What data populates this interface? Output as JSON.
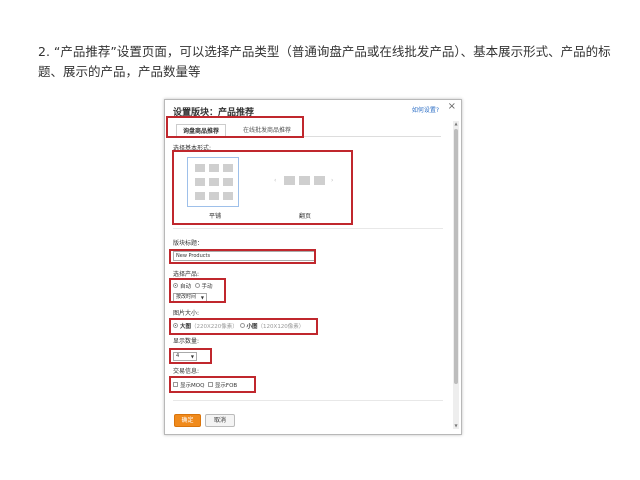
{
  "caption": "2. “产品推荐”设置页面，可以选择产品类型（普通询盘产品或在线批发产品）、基本展示形式、产品的标题、展示的产品，产品数量等",
  "dialog": {
    "title": "设置版块：产品推荐",
    "help_link": "如何设置?",
    "close": "×",
    "tabs": [
      "询盘商品推荐",
      "在线批发商品推荐"
    ]
  },
  "layout_section": {
    "label": "选择基本形式:",
    "options": [
      "平铺",
      "翻页"
    ]
  },
  "title_section": {
    "label": "版块标题：",
    "value": "New Products"
  },
  "product_section": {
    "label": "选择产品:",
    "radio_auto": "自动",
    "radio_manual": "手动",
    "sort_value": "按改时间"
  },
  "image_section": {
    "label": "图片大小:",
    "large": "大图",
    "large_size": "（220X220像素）",
    "small": "小图",
    "small_size": "（120X120像素）"
  },
  "count_section": {
    "label": "显示数量:",
    "value": "4"
  },
  "trade_section": {
    "label": "交易信息:",
    "moq": "显示MOQ",
    "fob": "显示FOB"
  },
  "buttons": {
    "ok": "确定",
    "cancel": "取消"
  },
  "colors": {
    "highlight": "#c0272d",
    "primary_button": "#f08a1c",
    "link": "#2a6dc5"
  }
}
